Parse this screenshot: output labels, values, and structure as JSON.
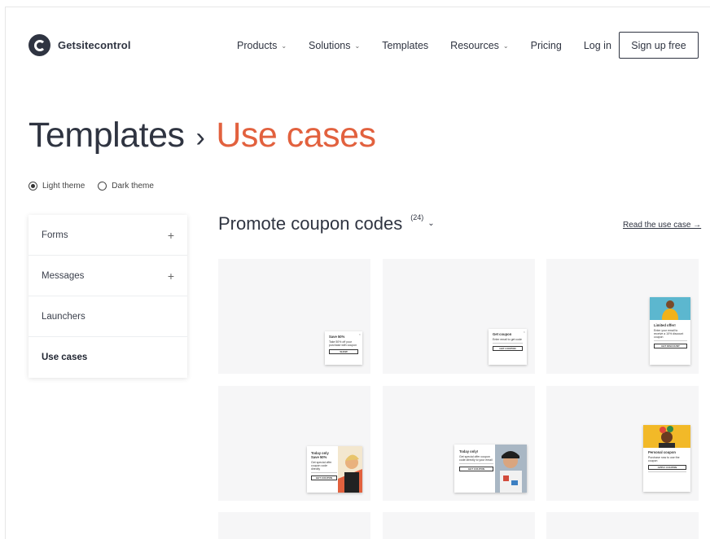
{
  "header": {
    "logo_text": "Getsitecontrol",
    "nav": [
      {
        "label": "Products",
        "dropdown": true
      },
      {
        "label": "Solutions",
        "dropdown": true
      },
      {
        "label": "Templates",
        "dropdown": false
      },
      {
        "label": "Resources",
        "dropdown": true
      },
      {
        "label": "Pricing",
        "dropdown": false
      },
      {
        "label": "Log in",
        "dropdown": false
      }
    ],
    "signup_label": "Sign up free",
    "chevron": "⌄"
  },
  "title": {
    "main": "Templates",
    "separator": "›",
    "accent": "Use cases",
    "accent_color": "#e2613e"
  },
  "themes": [
    {
      "label": "Light theme",
      "selected": true
    },
    {
      "label": "Dark theme",
      "selected": false
    }
  ],
  "sidebar": {
    "items": [
      {
        "label": "Forms",
        "expandable": true
      },
      {
        "label": "Messages",
        "expandable": true
      },
      {
        "label": "Launchers",
        "expandable": false
      },
      {
        "label": "Use cases",
        "expandable": false,
        "active": true
      }
    ],
    "plus": "+"
  },
  "main": {
    "heading": "Promote coupon codes",
    "count": "(24)",
    "chevron": "⌄",
    "read_link": "Read the use case →"
  },
  "cards": [
    {
      "title": "Save 50%",
      "text": "Take 50% off your purchase with coupon",
      "button": "SHOW"
    },
    {
      "title": "Get coupon",
      "text": "Enter email to get code",
      "button": "GET COUPON"
    },
    {
      "title": "Limited offer!",
      "text": "Enter your email to receive a 10% discount coupon",
      "button": "GET DISCOUNT"
    },
    {
      "title": "Today only Save 50%",
      "text": "Get special offer coupon code directly",
      "button": "GET COUPON"
    },
    {
      "title": "Today only!",
      "text": "Get special offer coupon code directly to your email",
      "button": "GET COUPON"
    },
    {
      "title": "Personal coupon",
      "text": "Purchase now to use the coupon",
      "button": "APPLY COUPON"
    }
  ],
  "icons": {
    "close": "×"
  },
  "colors": {
    "text": "#2f3441",
    "accent": "#e2613e",
    "card_bg": "#f6f6f7"
  }
}
